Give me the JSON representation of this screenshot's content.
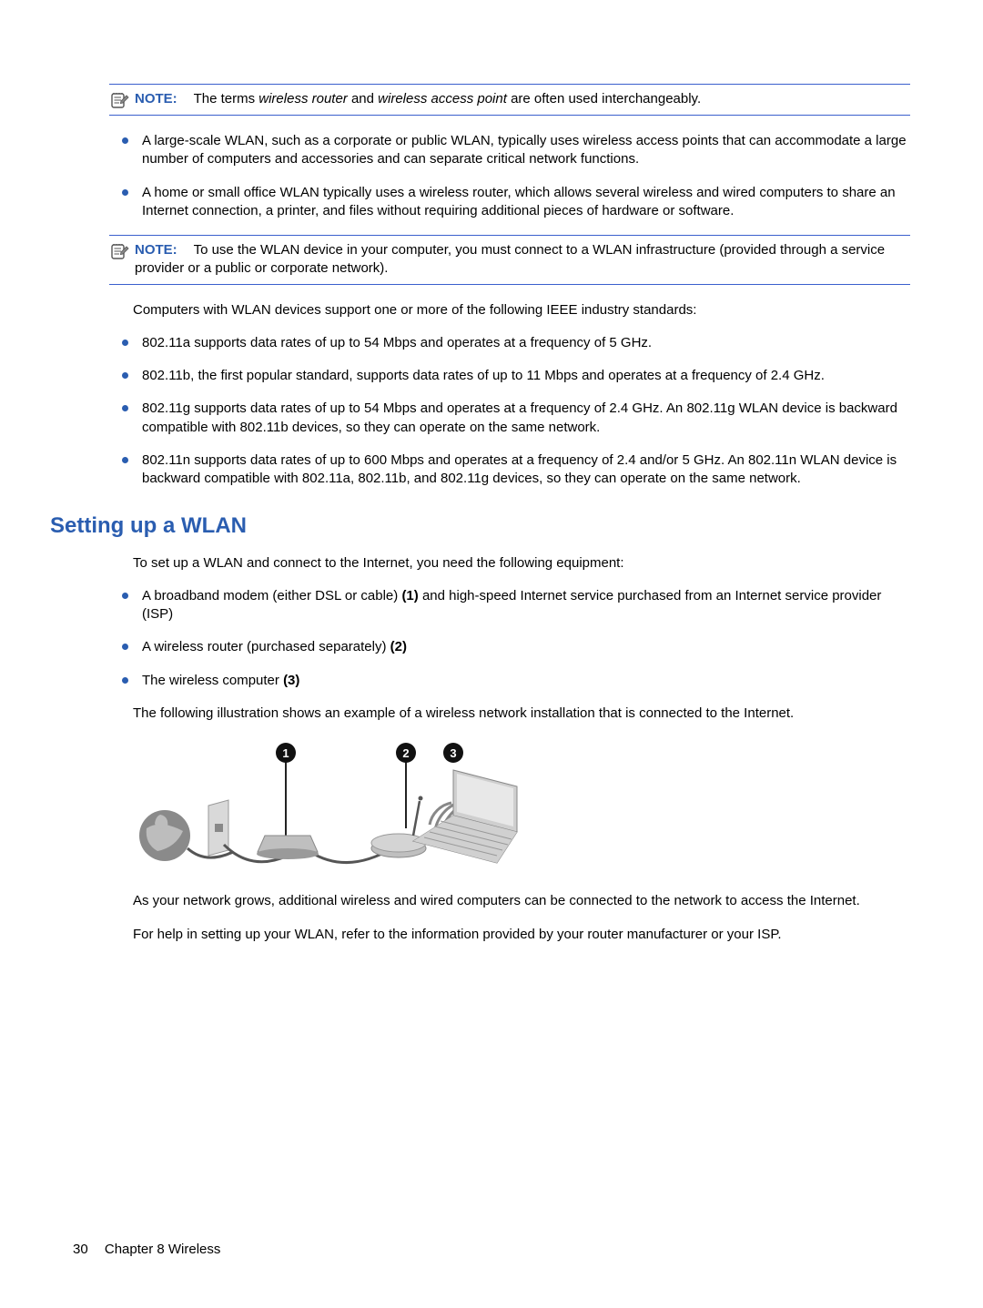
{
  "notes": {
    "note1": {
      "label": "NOTE:",
      "pre": "The terms ",
      "em1": "wireless router",
      "mid": " and ",
      "em2": "wireless access point",
      "post": " are often used interchangeably."
    },
    "note2": {
      "label": "NOTE:",
      "text": "To use the WLAN device in your computer, you must connect to a WLAN infrastructure (provided through a service provider or a public or corporate network)."
    }
  },
  "bullets1": [
    "A large-scale WLAN, such as a corporate or public WLAN, typically uses wireless access points that can accommodate a large number of computers and accessories and can separate critical network functions.",
    "A home or small office WLAN typically uses a wireless router, which allows several wireless and wired computers to share an Internet connection, a printer, and files without requiring additional pieces of hardware or software."
  ],
  "para_standards": "Computers with WLAN devices support one or more of the following IEEE industry standards:",
  "bullets2": [
    "802.11a supports data rates of up to 54 Mbps and operates at a frequency of 5 GHz.",
    "802.11b, the first popular standard, supports data rates of up to 11 Mbps and operates at a frequency of 2.4 GHz.",
    "802.11g supports data rates of up to 54 Mbps and operates at a frequency of 2.4 GHz. An 802.11g WLAN device is backward compatible with 802.11b devices, so they can operate on the same network.",
    "802.11n supports data rates of up to 600 Mbps and operates at a frequency of 2.4 and/or 5 GHz. An 802.11n WLAN device is backward compatible with 802.11a, 802.11b, and 802.11g devices, so they can operate on the same network."
  ],
  "heading": "Setting up a WLAN",
  "para_setup": "To set up a WLAN and connect to the Internet, you need the following equipment:",
  "bullets3": [
    {
      "pre": "A broadband modem (either DSL or cable) ",
      "bold": "(1)",
      "post": " and high-speed Internet service purchased from an Internet service provider (ISP)"
    },
    {
      "pre": "A wireless router (purchased separately) ",
      "bold": "(2)",
      "post": ""
    },
    {
      "pre": "The wireless computer ",
      "bold": "(3)",
      "post": ""
    }
  ],
  "para_illustration": "The following illustration shows an example of a wireless network installation that is connected to the Internet.",
  "illustration_labels": {
    "one": "1",
    "two": "2",
    "three": "3"
  },
  "para_grows": "As your network grows, additional wireless and wired computers can be connected to the network to access the Internet.",
  "para_help": "For help in setting up your WLAN, refer to the information provided by your router manufacturer or your ISP.",
  "footer": {
    "page_num": "30",
    "chapter": "Chapter 8   Wireless"
  }
}
